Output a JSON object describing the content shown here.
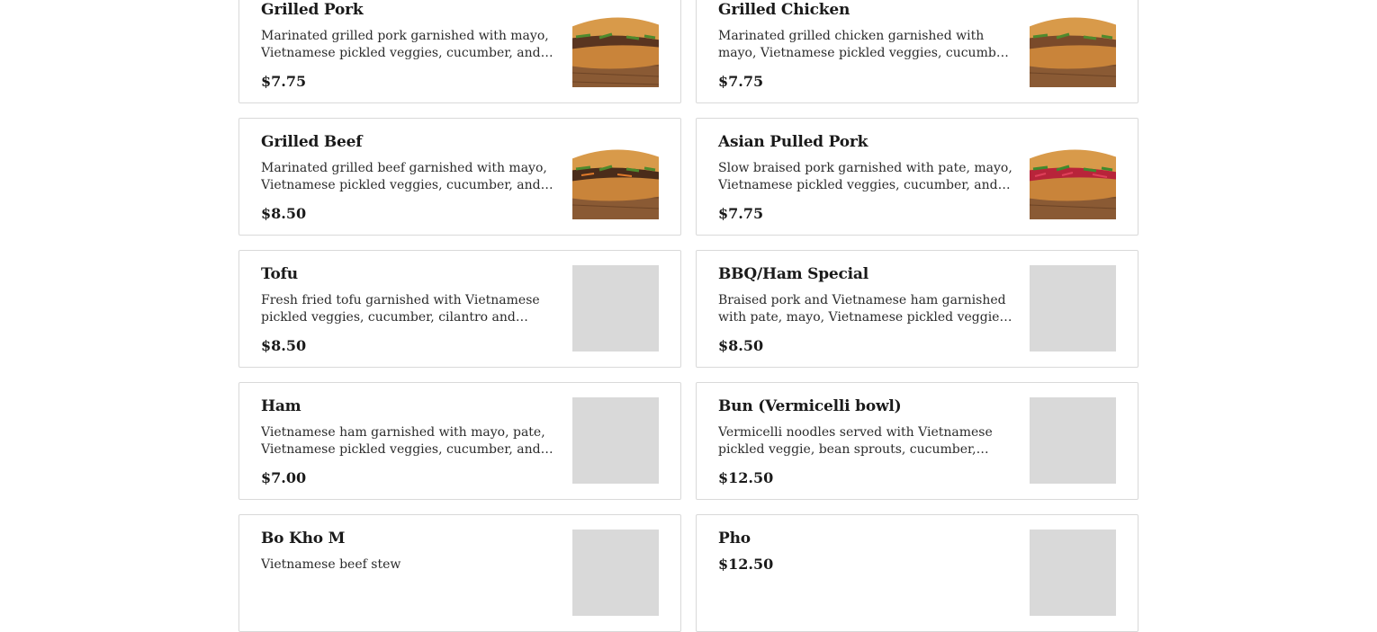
{
  "menu": {
    "items": [
      {
        "name": "Grilled Pork",
        "description": "Marinated grilled pork garnished with mayo, Vietnamese pickled veggies, cucumber, and cilantro",
        "price": "$7.75",
        "image": "banh-mi-sandwich-photo"
      },
      {
        "name": "Grilled Chicken",
        "description": "Marinated grilled chicken garnished with mayo, Vietnamese pickled veggies, cucumber, and cilantro",
        "price": "$7.75",
        "image": "banh-mi-sandwich-photo"
      },
      {
        "name": "Grilled Beef",
        "description": "Marinated grilled beef garnished with mayo, Vietnamese pickled veggies, cucumber, and cilantro",
        "price": "$8.50",
        "image": "banh-mi-sandwich-photo"
      },
      {
        "name": "Asian Pulled Pork",
        "description": "Slow braised pork garnished with pate, mayo, Vietnamese pickled veggies, cucumber, and cilantro",
        "price": "$7.75",
        "image": "banh-mi-sandwich-photo"
      },
      {
        "name": "Tofu",
        "description": "Fresh fried tofu garnished with Vietnamese pickled veggies, cucumber, cilantro and jalapeno peppers",
        "price": "$8.50",
        "image": "image-placeholder"
      },
      {
        "name": "BBQ/Ham Special",
        "description": "Braised pork and Vietnamese ham garnished with pate, mayo, Vietnamese pickled veggies, cucumber, and cilantro",
        "price": "$8.50",
        "image": "image-placeholder"
      },
      {
        "name": "Ham",
        "description": "Vietnamese ham garnished with mayo, pate, Vietnamese pickled veggies, cucumber, and cilantro",
        "price": "$7.00",
        "image": "image-placeholder"
      },
      {
        "name": "Bun (Vermicelli bowl)",
        "description": "Vermicelli noodles served with Vietnamese pickled veggie, bean sprouts, cucumber, mints, and cilantro",
        "price": "$12.50",
        "image": "image-placeholder"
      },
      {
        "name": "Bo Kho M",
        "description": "Vietnamese beef stew",
        "price": "",
        "image": "image-placeholder"
      },
      {
        "name": "Pho",
        "description": "",
        "price": "$12.50",
        "image": "image-placeholder"
      }
    ]
  }
}
